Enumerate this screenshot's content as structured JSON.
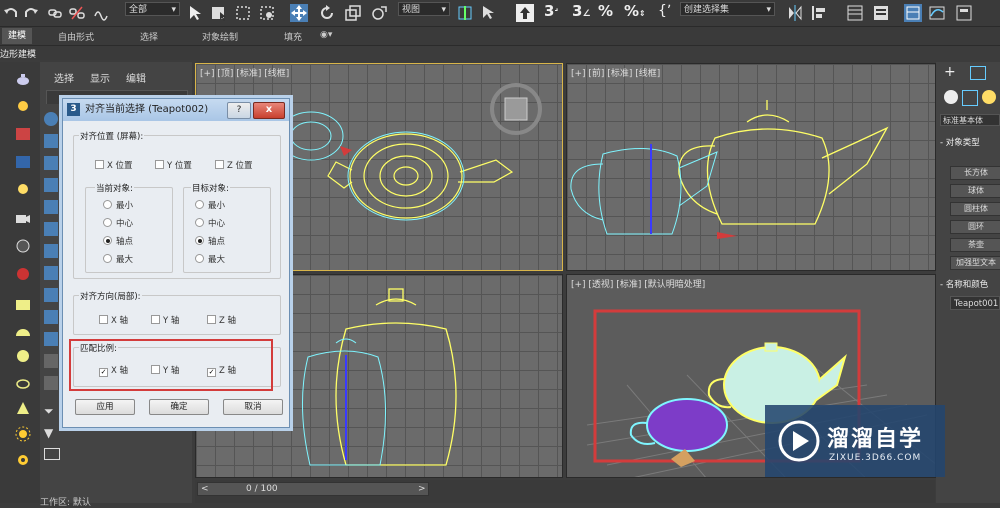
{
  "toolbar": {
    "filter_dropdown": "全部",
    "refcoord_dropdown": "视图",
    "selset_dropdown": "创建选择集",
    "snap_label": "3",
    "angle_snap_label": "3",
    "percent_snap_label": "%",
    "spinner_snap_label": "%"
  },
  "ribbon": {
    "tabs": [
      "建模",
      "自由形式",
      "选择",
      "对象绘制",
      "填充"
    ],
    "subtitle": "边形建模"
  },
  "explorer": {
    "menu": [
      "选择",
      "显示",
      "编辑"
    ]
  },
  "viewports": {
    "top_label": "[+] [顶] [标准] [线框]",
    "front_label": "[+] [前] [标准] [线框]",
    "left_label": "[+]",
    "persp_label": "[+] [透视] [标准] [默认明暗处理]"
  },
  "dialog": {
    "title": "对齐当前选择 (Teapot002)",
    "icon_char": "3",
    "help_btn": "?",
    "close_btn": "x",
    "align_pos_title": "对齐位置 (屏幕):",
    "axis_x": "X 位置",
    "axis_y": "Y 位置",
    "axis_z": "Z 位置",
    "current_obj_title": "当前对象:",
    "target_obj_title": "目标对象:",
    "radio_min": "最小",
    "radio_center": "中心",
    "radio_pivot": "轴点",
    "radio_max": "最大",
    "orient_title": "对齐方向(局部):",
    "orient_x": "X 轴",
    "orient_y": "Y 轴",
    "orient_z": "Z 轴",
    "scale_title": "匹配比例:",
    "scale_x": "X 轴",
    "scale_y": "Y 轴",
    "scale_z": "Z 轴",
    "btn_apply": "应用",
    "btn_ok": "确定",
    "btn_cancel": "取消"
  },
  "cmdpanel": {
    "dropdown": "标准基本体",
    "object_type_title": "对象类型",
    "buttons": [
      "长方体",
      "球体",
      "圆柱体",
      "圆环",
      "茶壶",
      "加强型文本"
    ],
    "name_color_title": "名称和颜色",
    "name_value": "Teapot001"
  },
  "timeline": {
    "frame": "0 / 100",
    "workspace": "工作区: 默认"
  },
  "watermark": {
    "title": "溜溜自学",
    "url": "ZIXUE.3D66.COM"
  },
  "colors": {
    "selection_highlight": "#d33c3c",
    "wire_yellow": "#ffff66",
    "wire_cyan": "#7ff5ff",
    "teapot_purple": "#7d3cc8",
    "teapot_mint": "#c9f0e4"
  }
}
